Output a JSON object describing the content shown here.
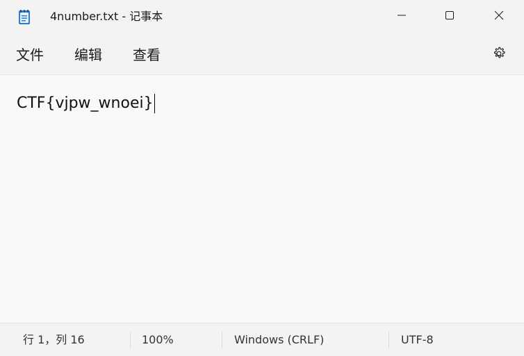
{
  "window": {
    "title": "4number.txt - 记事本",
    "app_icon": "notepad-icon"
  },
  "controls": {
    "minimize_icon": "minimize-icon",
    "maximize_icon": "maximize-icon",
    "close_icon": "close-icon"
  },
  "menu": {
    "items": [
      {
        "label": "文件"
      },
      {
        "label": "编辑"
      },
      {
        "label": "查看"
      }
    ],
    "settings_icon": "gear-icon"
  },
  "editor": {
    "content": "CTF{vjpw_wnoei}"
  },
  "status": {
    "position": "行 1，列 16",
    "zoom": "100%",
    "line_ending": "Windows (CRLF)",
    "encoding": "UTF-8"
  },
  "colors": {
    "background": "#f3f3f3",
    "editor_background": "#f9f9f9",
    "icon_accent": "#1f6fb2"
  }
}
